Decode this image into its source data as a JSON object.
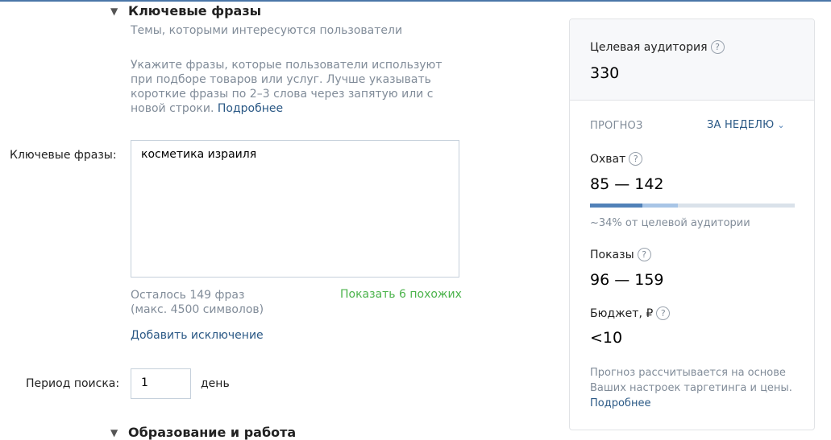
{
  "left": {
    "keywords_section_title": "Ключевые фразы",
    "subtitle": "Темы, которыми интересуются пользователи",
    "hint": "Укажите фразы, которые пользователи используют при подборе товаров или услуг. Лучше указывать короткие фразы по 2–3 слова через запятую или с новой строки.",
    "hint_link": "Подробнее",
    "keywords_label": "Ключевые фразы:",
    "keywords_value": "косметика израиля",
    "remaining_line1": "Осталось 149 фраз",
    "remaining_line2": "(макс. 4500 символов)",
    "show_similar": "Показать 6 похожих",
    "add_exclusion": "Добавить исключение",
    "period_label": "Период поиска:",
    "period_value": "1",
    "period_unit": "день",
    "education_section_title": "Образование и работа"
  },
  "panel": {
    "audience_label": "Целевая аудитория",
    "audience_value": "330",
    "forecast_label": "ПРОГНОЗ",
    "forecast_period": "ЗА НЕДЕЛЮ",
    "reach_label": "Охват",
    "reach_value": "85 — 142",
    "reach_bar": {
      "low_fraction": 0.257,
      "high_fraction": 0.43
    },
    "reach_percent": "~34% от целевой аудитории",
    "impressions_label": "Показы",
    "impressions_value": "96 — 159",
    "budget_label": "Бюджет, ₽",
    "budget_value": "<10",
    "note": "Прогноз рассчитывается на основе Ваших настроек таргетинга и цены.",
    "note_link": "Подробнее",
    "help_glyph": "?"
  },
  "icons": {
    "collapse": "▼",
    "chevron": "⌄"
  },
  "colors": {
    "link": "#2a5885",
    "green_link": "#4bb34b",
    "bar_dark": "#5181b8",
    "bar_light": "#a8c5e6",
    "muted_text": "#818c99"
  }
}
